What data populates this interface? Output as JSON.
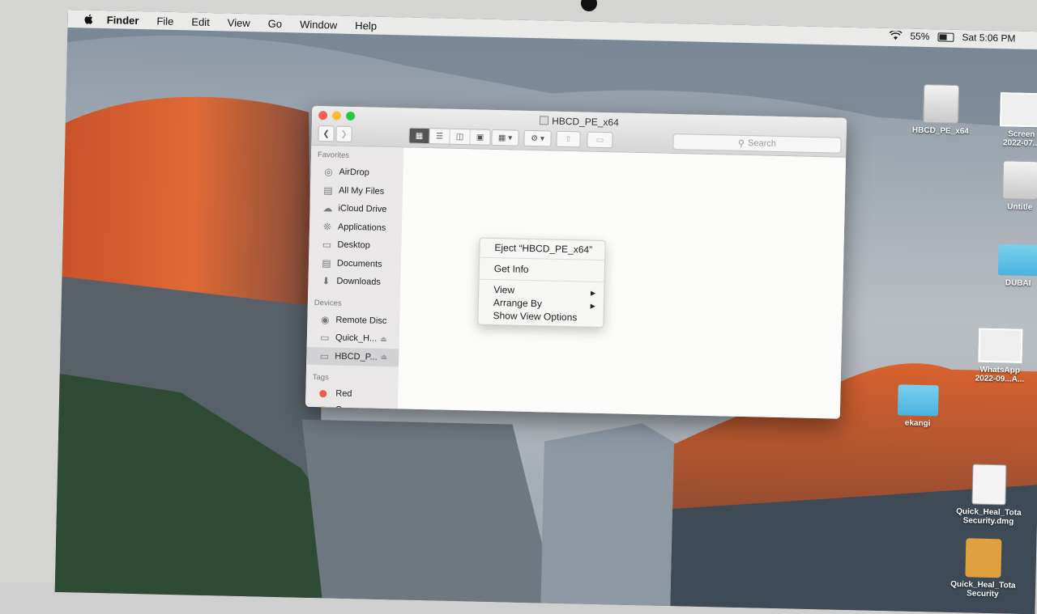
{
  "menubar": {
    "app_name": "Finder",
    "items": [
      "File",
      "Edit",
      "View",
      "Go",
      "Window",
      "Help"
    ],
    "battery": "55%",
    "clock": "Sat 5:06 PM"
  },
  "desktop": {
    "icons": [
      {
        "label": "HBCD_PE_x64",
        "kind": "drive"
      },
      {
        "label": "Screen\n2022-07...",
        "kind": "thumb"
      },
      {
        "label": "Untitle",
        "kind": "drive"
      },
      {
        "label": "DUBAI",
        "kind": "folder"
      },
      {
        "label": "WhatsApp\n2022-09...A...",
        "kind": "thumb"
      },
      {
        "label": "ekangi",
        "kind": "folder"
      },
      {
        "label": "Quick_Heal_Tota\nSecurity.dmg",
        "kind": "dmg"
      },
      {
        "label": "Quick_Heal_Tota\nSecurity",
        "kind": "pkg"
      }
    ]
  },
  "finder": {
    "title": "HBCD_PE_x64",
    "search_placeholder": "Search",
    "favorites_header": "Favorites",
    "favorites": [
      {
        "label": "AirDrop",
        "icon": "airdrop-icon"
      },
      {
        "label": "All My Files",
        "icon": "all-files-icon"
      },
      {
        "label": "iCloud Drive",
        "icon": "cloud-icon"
      },
      {
        "label": "Applications",
        "icon": "applications-icon"
      },
      {
        "label": "Desktop",
        "icon": "desktop-icon"
      },
      {
        "label": "Documents",
        "icon": "documents-icon"
      },
      {
        "label": "Downloads",
        "icon": "downloads-icon"
      }
    ],
    "devices_header": "Devices",
    "devices": [
      {
        "label": "Remote Disc",
        "icon": "disc-icon"
      },
      {
        "label": "Quick_H...",
        "icon": "drive-icon"
      },
      {
        "label": "HBCD_P...",
        "icon": "drive-icon"
      }
    ],
    "tags_header": "Tags",
    "tags": [
      {
        "label": "Red",
        "color": "#f05a4b"
      },
      {
        "label": "Orange",
        "color": "#f5a623"
      }
    ]
  },
  "context_menu": {
    "eject": "Eject “HBCD_PE_x64”",
    "get_info": "Get Info",
    "view": "View",
    "arrange_by": "Arrange By",
    "show_view_options": "Show View Options"
  }
}
